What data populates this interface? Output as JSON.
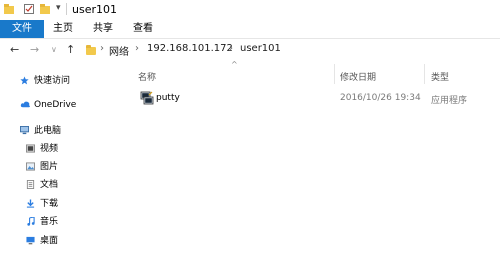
{
  "window": {
    "title": "user101"
  },
  "ribbon": {
    "tabs": [
      "文件",
      "主页",
      "共享",
      "查看"
    ]
  },
  "address": {
    "crumbs": [
      "网络",
      "192.168.101.172",
      "user101"
    ]
  },
  "sidebar": {
    "quick_access": "快速访问",
    "onedrive": "OneDrive",
    "this_pc": "此电脑",
    "items": [
      "视频",
      "图片",
      "文档",
      "下载",
      "音乐",
      "桌面"
    ]
  },
  "columns": {
    "name": "名称",
    "date": "修改日期",
    "type": "类型"
  },
  "files": [
    {
      "name": "putty",
      "date": "2016/10/26 19:34",
      "type": "应用程序"
    }
  ],
  "colors": {
    "accent": "#1979ca"
  }
}
